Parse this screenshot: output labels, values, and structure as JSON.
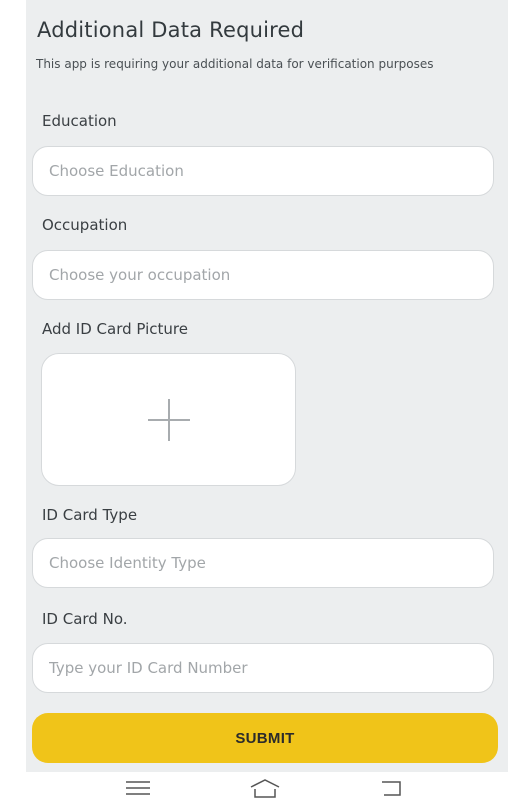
{
  "header": {
    "title": "Additional Data Required",
    "subtitle": "This app is requiring your additional data for verification purposes"
  },
  "form": {
    "education": {
      "label": "Education",
      "placeholder": "Choose Education"
    },
    "occupation": {
      "label": "Occupation",
      "placeholder": "Choose your occupation"
    },
    "id_picture": {
      "label": "Add ID Card Picture",
      "icon": "plus-icon"
    },
    "id_type": {
      "label": "ID Card Type",
      "placeholder": "Choose Identity Type"
    },
    "id_number": {
      "label": "ID Card No.",
      "placeholder": "Type your ID Card Number"
    },
    "submit_label": "SUBMIT"
  },
  "navbar": {
    "icons": [
      "menu-icon",
      "home-icon",
      "back-icon"
    ]
  },
  "colors": {
    "background": "#eceeef",
    "accent": "#f0c419",
    "input_background": "#ffffff"
  }
}
